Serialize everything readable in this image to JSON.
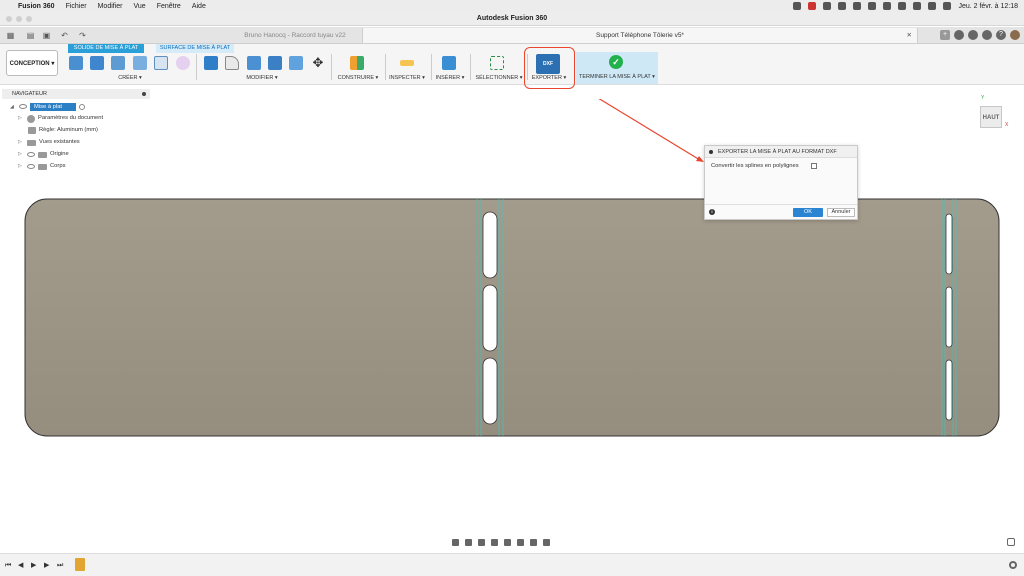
{
  "mac_menu": {
    "app": "Fusion 360",
    "items": [
      "Fichier",
      "Modifier",
      "Vue",
      "Fenêtre",
      "Aide"
    ],
    "datetime": "Jeu. 2 févr. à 12:18"
  },
  "window": {
    "title": "Autodesk Fusion 360"
  },
  "tabs": [
    {
      "label": "Bruno Hanocq - Raccord tuyau v22",
      "active": false
    },
    {
      "label": "Support Téléphone Tôlerie v5*",
      "active": true
    }
  ],
  "toolbar": {
    "workspace": "CONCEPTION",
    "subtabs": [
      "SOLIDE DE MISE À PLAT",
      "SURFACE DE MISE À PLAT"
    ],
    "groups": {
      "create": "CRÉER",
      "modify": "MODIFIER",
      "construct": "CONSTRUIRE",
      "inspect": "INSPECTER",
      "insert": "INSÉRER",
      "select": "SÉLECTIONNER",
      "export": "EXPORTER",
      "finish": "TERMINER LA MISE À PLAT"
    },
    "export_icon_text": "DXF"
  },
  "navigator": {
    "header": "NAVIGATEUR",
    "root": "Mise à plat",
    "items": [
      "Paramètres du document",
      "Règle: Aluminum (mm)",
      "Vues existantes",
      "Origine",
      "Corps"
    ]
  },
  "viewcube": {
    "face": "HAUT",
    "axis_y": "Y",
    "axis_x": "X"
  },
  "dialog": {
    "title": "EXPORTER LA MISE À PLAT AU FORMAT DXF",
    "option_label": "Convertir les splines en polylignes",
    "option_checked": false,
    "ok": "OK",
    "cancel": "Annuler",
    "info": "i"
  },
  "colors": {
    "part_fill": "#9c9484",
    "accent_blue": "#2a9fd8",
    "highlight_red": "#e8472e",
    "finish_green": "#23b14d"
  }
}
